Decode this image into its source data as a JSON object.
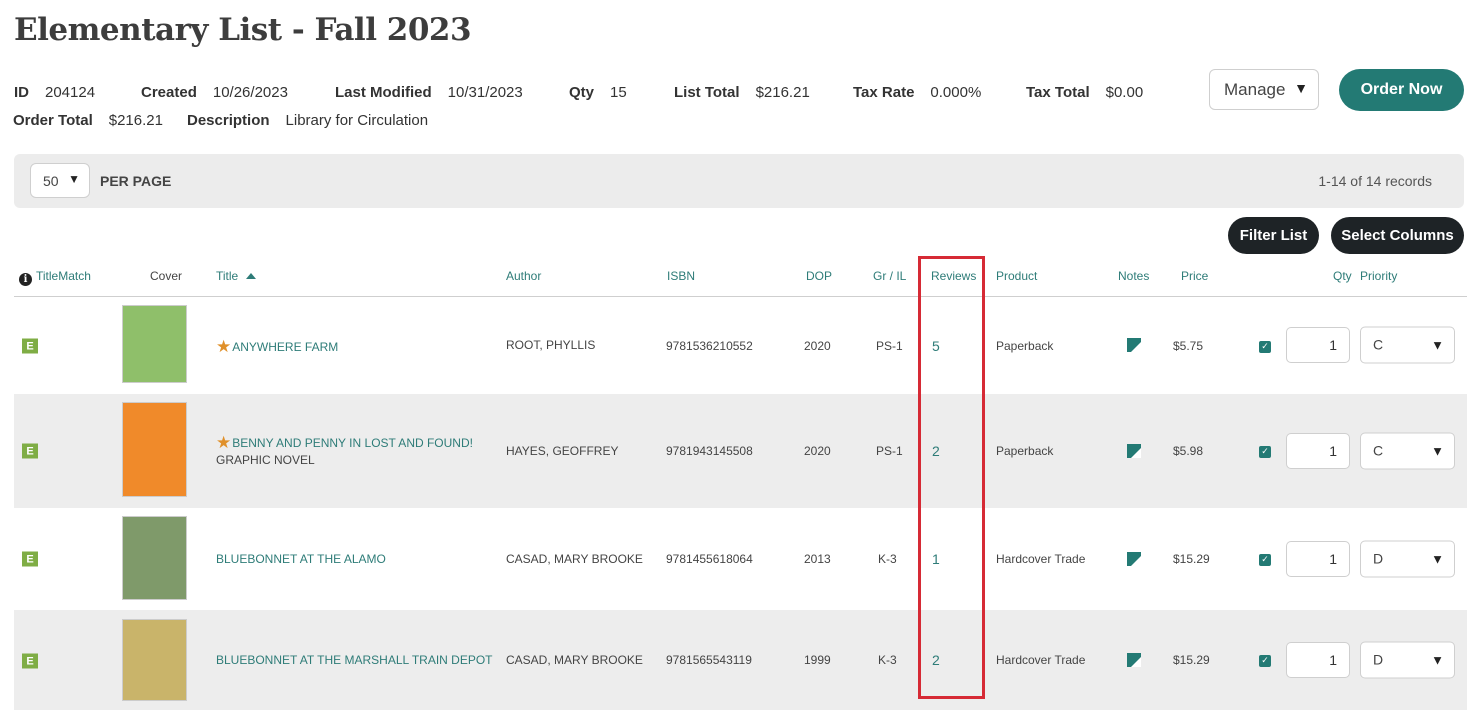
{
  "page": {
    "title": "Elementary List - Fall 2023"
  },
  "meta": {
    "id_label": "ID",
    "id_value": "204124",
    "created_label": "Created",
    "created_value": "10/26/2023",
    "modified_label": "Last Modified",
    "modified_value": "10/31/2023",
    "qty_label": "Qty",
    "qty_value": "15",
    "list_total_label": "List Total",
    "list_total_value": "$216.21",
    "tax_rate_label": "Tax Rate",
    "tax_rate_value": "0.000%",
    "tax_total_label": "Tax Total",
    "tax_total_value": "$0.00",
    "order_total_label": "Order Total",
    "order_total_value": "$216.21",
    "description_label": "Description",
    "description_value": "Library for Circulation"
  },
  "actions": {
    "manage_label": "Manage",
    "order_now_label": "Order Now",
    "filter_list_label": "Filter List",
    "select_columns_label": "Select Columns"
  },
  "pager": {
    "per_page_value": "50",
    "per_page_label": "PER PAGE",
    "records_text": "1-14 of 14 records"
  },
  "table": {
    "headers": {
      "titlematch": "TitleMatch",
      "cover": "Cover",
      "title": "Title",
      "author": "Author",
      "isbn": "ISBN",
      "dop": "DOP",
      "grade": "Gr / IL",
      "reviews": "Reviews",
      "product": "Product",
      "notes": "Notes",
      "price": "Price",
      "qty": "Qty",
      "priority": "Priority"
    },
    "rows": [
      {
        "badge": "E",
        "title_line1": "ANYWHERE FARM",
        "title_line2": "",
        "author": "ROOT, PHYLLIS",
        "isbn": "9781536210552",
        "dop": "2020",
        "grade": "PS-1",
        "reviews": "5",
        "product": "Paperback",
        "price": "$5.75",
        "qty": "1",
        "priority": "C",
        "cover_bg": "#8fbf6a"
      },
      {
        "badge": "E",
        "title_line1": "BENNY AND PENNY IN LOST AND FOUND!",
        "title_line2": "GRAPHIC NOVEL",
        "author": "HAYES, GEOFFREY",
        "isbn": "9781943145508",
        "dop": "2020",
        "grade": "PS-1",
        "reviews": "2",
        "product": "Paperback",
        "price": "$5.98",
        "qty": "1",
        "priority": "C",
        "cover_bg": "#f08a2a"
      },
      {
        "badge": "E",
        "title_line1": "BLUEBONNET AT THE ALAMO",
        "title_line2": "",
        "author": "CASAD, MARY BROOKE",
        "isbn": "9781455618064",
        "dop": "2013",
        "grade": "K-3",
        "reviews": "1",
        "product": "Hardcover Trade",
        "price": "$15.29",
        "qty": "1",
        "priority": "D",
        "cover_bg": "#7f9a6a"
      },
      {
        "badge": "E",
        "title_line1": "BLUEBONNET AT THE MARSHALL TRAIN DEPOT",
        "title_line2": "",
        "author": "CASAD, MARY BROOKE",
        "isbn": "9781565543119",
        "dop": "1999",
        "grade": "K-3",
        "reviews": "2",
        "product": "Hardcover Trade",
        "price": "$15.29",
        "qty": "1",
        "priority": "D",
        "cover_bg": "#c9b46a"
      }
    ]
  },
  "colors": {
    "accent": "#237a74",
    "link": "#2e7c78",
    "badge": "#7fad45",
    "highlight": "#d62a35"
  }
}
